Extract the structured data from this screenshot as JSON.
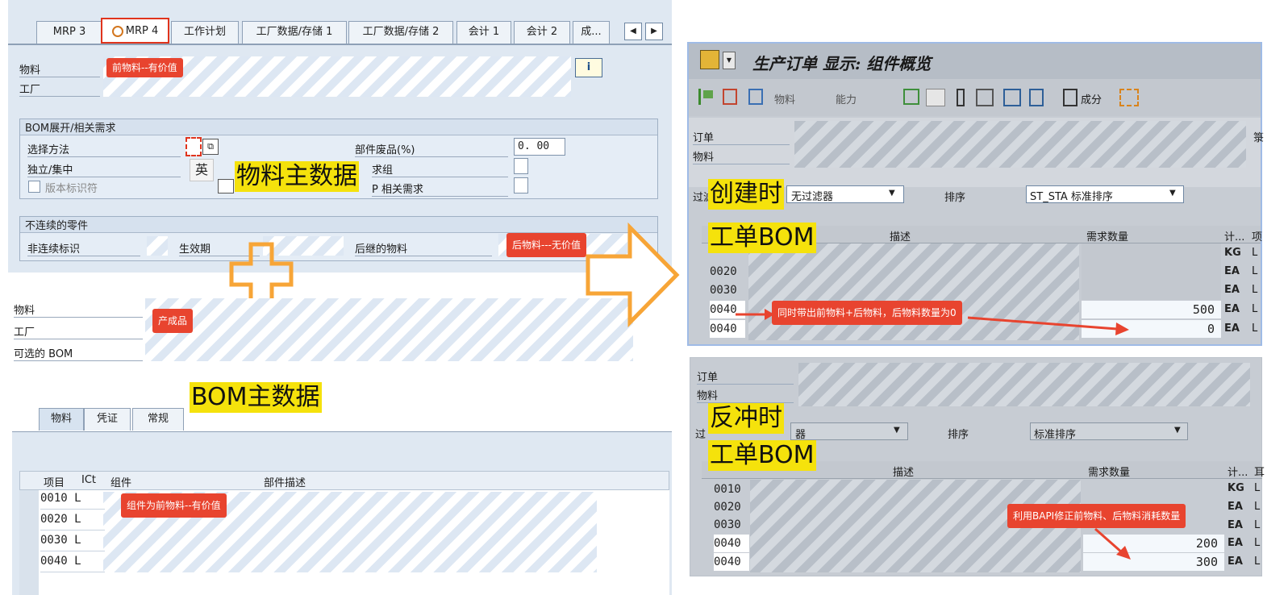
{
  "top_left": {
    "tabs": [
      "MRP 3",
      "MRP 4",
      "工作计划",
      "工厂数据/存储 1",
      "工厂数据/存储 2",
      "会计 1",
      "会计 2",
      "成..."
    ],
    "active_tab": "MRP 4",
    "material_label": "物料",
    "plant_label": "工厂",
    "tag_prev_material": "前物料--有价值",
    "bom_section_title": "BOM展开/相关需求",
    "selection_method_label": "选择方法",
    "independent_label": "独立/集中",
    "version_label": "版本标识符",
    "component_scrap_label": "部件废品(%)",
    "component_scrap_value": "0. 00",
    "req_group_label": "求组",
    "mrp_dep_label": "P 相关需求",
    "ime_char": "英",
    "yellow_title": "物料主数据",
    "discontinued_section_title": "不连续的零件",
    "discontinued_label": "非连续标识",
    "effective_label": "生效期",
    "follow_up_label": "后继的物料",
    "tag_next_material": "后物料---无价值"
  },
  "bottom_left": {
    "material_label": "物料",
    "plant_label": "工厂",
    "alt_bom_label": "可选的 BOM",
    "tag_product": "产成品",
    "yellow_title": "BOM主数据",
    "tabs": [
      "物料",
      "凭证",
      "常规"
    ],
    "headers": [
      "项目",
      "ICt",
      "组件",
      "部件描述"
    ],
    "rows": [
      {
        "item": "0010",
        "ict": "L"
      },
      {
        "item": "0020",
        "ict": "L"
      },
      {
        "item": "0030",
        "ict": "L"
      },
      {
        "item": "0040",
        "ict": "L"
      }
    ],
    "tag_component": "组件为前物料--有价值"
  },
  "right_top": {
    "window_title": "生产订单 显示: 组件概览",
    "toolbar_material": "物料",
    "toolbar_capacity": "能力",
    "toolbar_components": "成分",
    "order_label": "订单",
    "material_label": "物料",
    "filter_label": "过滤",
    "filter_value": "无过滤器",
    "sort_label": "排序",
    "sort_value": "ST_STA 标准排序",
    "yellow_line1": "创建时",
    "yellow_line2": "工单BOM",
    "col_desc": "描述",
    "col_req_qty": "需求数量",
    "col_unit": "计...",
    "col_extra": "项",
    "rows": [
      {
        "item": "",
        "qty": "",
        "unit": "KG",
        "cat": "L"
      },
      {
        "item": "0020",
        "qty": "",
        "unit": "EA",
        "cat": "L"
      },
      {
        "item": "0030",
        "qty": "",
        "unit": "EA",
        "cat": "L"
      },
      {
        "item": "0040",
        "qty": "500",
        "unit": "EA",
        "cat": "L"
      },
      {
        "item": "0040",
        "qty": "0",
        "unit": "EA",
        "cat": "L"
      }
    ],
    "tag_note": "同时带出前物料+后物料，后物料数量为0",
    "side_char": "箓"
  },
  "right_bottom": {
    "order_label": "订单",
    "material_label": "物料",
    "filter_label": "过",
    "filter_value": "器",
    "sort_label": "排序",
    "sort_value": "标准排序",
    "yellow_line1": "反冲时",
    "yellow_line2": "工单BOM",
    "col_desc": "描述",
    "col_req_qty": "需求数量",
    "col_unit": "计...",
    "col_extra": "耳",
    "rows": [
      {
        "item": "0010",
        "qty": "",
        "unit": "KG",
        "cat": "L"
      },
      {
        "item": "0020",
        "qty": "",
        "unit": "EA",
        "cat": "L"
      },
      {
        "item": "0030",
        "qty": "",
        "unit": "EA",
        "cat": "L"
      },
      {
        "item": "0040",
        "qty": "200",
        "unit": "EA",
        "cat": "L"
      },
      {
        "item": "0040",
        "qty": "300",
        "unit": "EA",
        "cat": "L"
      }
    ],
    "tag_note": "利用BAPI修正前物料、后物料消耗数量"
  },
  "colors": {
    "accent_red": "#e8442f",
    "highlight_yellow": "#f5e20c",
    "arrow_orange": "#f7a537"
  }
}
